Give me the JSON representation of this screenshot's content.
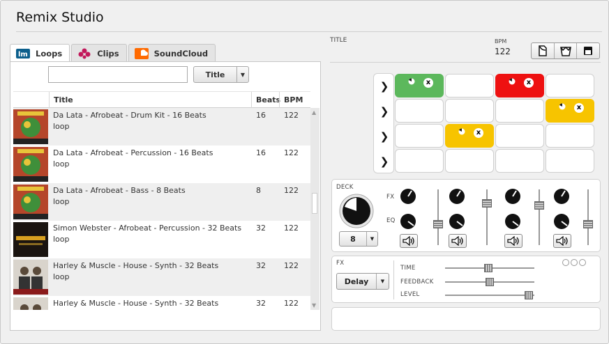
{
  "app": {
    "title": "Remix Studio"
  },
  "tabs": [
    {
      "label": "Loops",
      "icon": "loopmasters-icon",
      "active": true
    },
    {
      "label": "Clips",
      "icon": "clips-icon",
      "active": false
    },
    {
      "label": "SoundCloud",
      "icon": "soundcloud-icon",
      "active": false
    }
  ],
  "search": {
    "value": "",
    "placeholder": ""
  },
  "sort": {
    "selected": "Title"
  },
  "table": {
    "headers": [
      "Title",
      "Beats",
      "BPM"
    ],
    "rows": [
      {
        "title": "Da Lata - Afrobeat - Drum Kit - 16 Beats",
        "type": "loop",
        "beats": "16",
        "bpm": "122",
        "cover": "afro-brasil"
      },
      {
        "title": "Da Lata - Afrobeat - Percussion - 16 Beats",
        "type": "loop",
        "beats": "16",
        "bpm": "122",
        "cover": "afro-brasil"
      },
      {
        "title": "Da Lata - Afrobeat - Bass - 8 Beats",
        "type": "loop",
        "beats": "8",
        "bpm": "122",
        "cover": "afro-brasil"
      },
      {
        "title": "Simon Webster - Afrobeat - Percussion - 32 Beats",
        "type": "loop",
        "beats": "32",
        "bpm": "122",
        "cover": "global-beatworks"
      },
      {
        "title": "Harley & Muscle - House - Synth - 32 Beats",
        "type": "loop",
        "beats": "32",
        "bpm": "122",
        "cover": "harley-muscle"
      },
      {
        "title": "Harley & Muscle - House - Synth - 32 Beats",
        "type": "",
        "beats": "32",
        "bpm": "122",
        "cover": "harley-muscle"
      }
    ]
  },
  "deck_header": {
    "title_label": "TITLE",
    "bpm_label": "BPM",
    "bpm_value": "122"
  },
  "toolbar_icons": [
    "new-doc-icon",
    "basket-icon",
    "save-icon"
  ],
  "clip_grid": {
    "rows": [
      [
        {
          "color": "#5cb85c",
          "playing": true
        },
        {
          "color": "#ffffff",
          "playing": false
        },
        {
          "color": "#ee1111",
          "playing": true
        },
        {
          "color": "#ffffff",
          "playing": false
        }
      ],
      [
        {
          "color": "#ffffff",
          "playing": false
        },
        {
          "color": "#ffffff",
          "playing": false
        },
        {
          "color": "#ffffff",
          "playing": false
        },
        {
          "color": "#f7c400",
          "playing": true
        }
      ],
      [
        {
          "color": "#ffffff",
          "playing": false
        },
        {
          "color": "#f7c400",
          "playing": true
        },
        {
          "color": "#ffffff",
          "playing": false
        },
        {
          "color": "#ffffff",
          "playing": false
        }
      ],
      [
        {
          "color": "#ffffff",
          "playing": false
        },
        {
          "color": "#ffffff",
          "playing": false
        },
        {
          "color": "#ffffff",
          "playing": false
        },
        {
          "color": "#ffffff",
          "playing": false
        }
      ]
    ]
  },
  "deck": {
    "label": "DECK",
    "fx_label": "FX",
    "eq_label": "EQ",
    "size_value": "8",
    "channel_faders": [
      0.35,
      0.8,
      0.75,
      0.35
    ]
  },
  "fx": {
    "label": "FX",
    "effect": "Delay",
    "params": [
      {
        "label": "TIME",
        "value": 0.48
      },
      {
        "label": "FEEDBACK",
        "value": 0.5
      },
      {
        "label": "LEVEL",
        "value": 0.98
      }
    ]
  }
}
